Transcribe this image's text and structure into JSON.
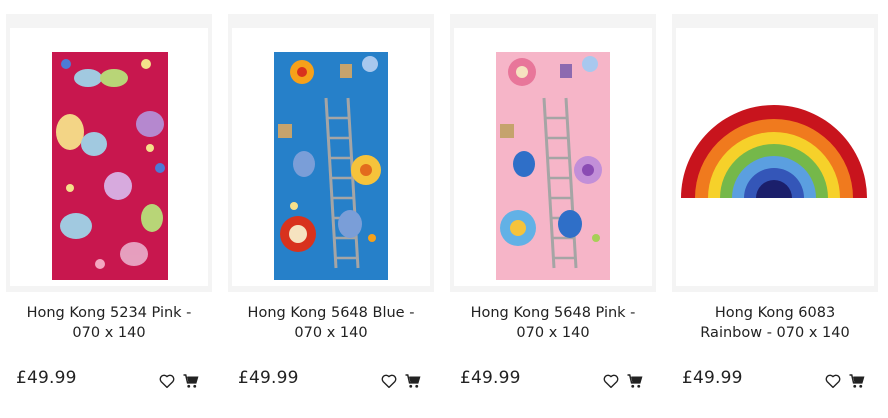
{
  "products": [
    {
      "title_line1": "Hong Kong 5234 Pink -",
      "title_line2": "070 x 140",
      "price": "£49.99",
      "image": "pink-butterfly-rug"
    },
    {
      "title_line1": "Hong Kong 5648 Blue -",
      "title_line2": "070 x 140",
      "price": "£49.99",
      "image": "blue-owl-ladder-rug"
    },
    {
      "title_line1": "Hong Kong 5648 Pink -",
      "title_line2": "070 x 140",
      "price": "£49.99",
      "image": "pink-owl-ladder-rug"
    },
    {
      "title_line1": "Hong Kong 6083",
      "title_line2": "Rainbow - 070 x 140",
      "price": "£49.99",
      "image": "rainbow-rug"
    }
  ],
  "icons": {
    "wishlist": "heart-icon",
    "cart": "cart-icon"
  },
  "colors": {
    "text": "#222222",
    "card_bg": "#f4f4f4"
  }
}
